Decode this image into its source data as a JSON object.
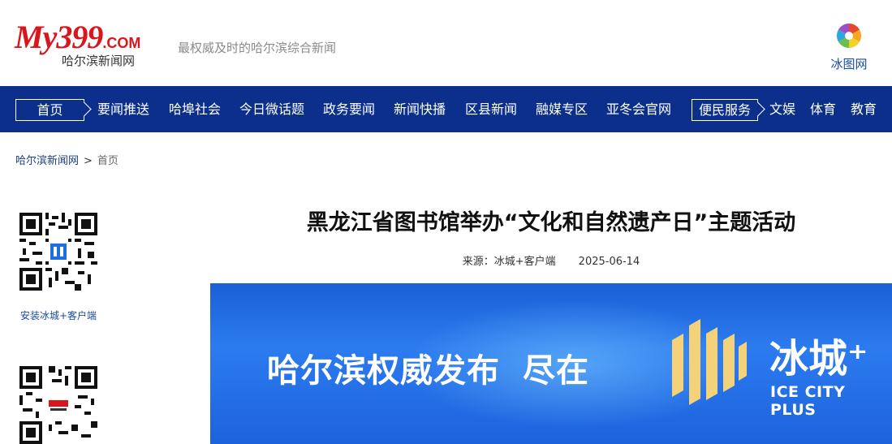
{
  "header": {
    "logo_main": "My399",
    "logo_domain": ".COM",
    "logo_sub": "哈尔滨新闻网",
    "slogan": "最权威及时的哈尔滨综合新闻",
    "ice_photo_label": "冰图网"
  },
  "nav": {
    "items": [
      {
        "label": "首页",
        "boxed": true
      },
      {
        "label": "要闻推送"
      },
      {
        "label": "哈埠社会"
      },
      {
        "label": "今日微话题"
      },
      {
        "label": "政务要闻"
      },
      {
        "label": "新闻快播"
      },
      {
        "label": "区县新闻"
      },
      {
        "label": "融媒专区"
      },
      {
        "label": "亚冬会官网"
      },
      {
        "label": "便民服务",
        "boxed": true
      },
      {
        "label": "文娱"
      },
      {
        "label": "体育"
      },
      {
        "label": "教育"
      }
    ]
  },
  "breadcrumb": {
    "home": "哈尔滨新闻网",
    "sep": ">",
    "current": "首页"
  },
  "sidebar": {
    "qr1_caption": "安装冰城+客户端"
  },
  "article": {
    "title": "黑龙江省图书馆举办“文化和自然遗产日”主题活动",
    "source": "来源：冰城+客户端",
    "date": "2025-06-14"
  },
  "banner": {
    "text_part1": "哈尔滨权威发布",
    "text_part2": "尽在",
    "brand": "冰城⁺",
    "brand_en": "ICE CITY PLUS"
  },
  "colors": {
    "nav_bg": "#0b2f8a",
    "brand_red": "#d8161c",
    "banner_blue": "#2c7bef",
    "banner_logo_gold": "#f4d27a"
  }
}
